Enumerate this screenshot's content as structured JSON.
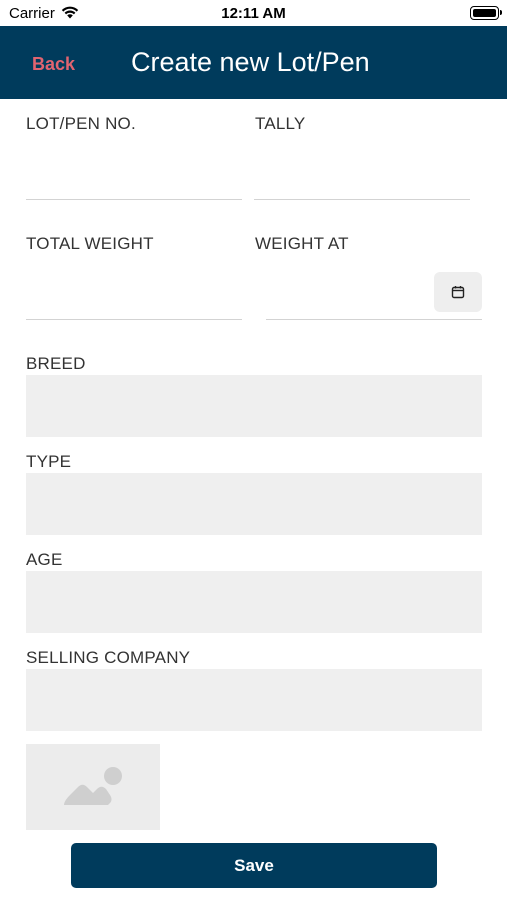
{
  "status_bar": {
    "carrier": "Carrier",
    "time": "12:11 AM"
  },
  "nav": {
    "back_label": "Back",
    "title": "Create new Lot/Pen"
  },
  "form": {
    "lot_pen_no": {
      "label": "LOT/PEN NO.",
      "value": ""
    },
    "tally": {
      "label": "TALLY",
      "value": ""
    },
    "total_weight": {
      "label": "TOTAL WEIGHT",
      "value": ""
    },
    "weight_at": {
      "label": "WEIGHT AT",
      "value": "",
      "icon": "calendar-icon"
    },
    "breed": {
      "label": "BREED",
      "value": ""
    },
    "type": {
      "label": "TYPE",
      "value": ""
    },
    "age": {
      "label": "AGE",
      "value": ""
    },
    "selling_company": {
      "label": "SELLING COMPANY",
      "value": ""
    },
    "photo": {
      "icon": "image-placeholder-icon"
    }
  },
  "actions": {
    "save_label": "Save"
  },
  "colors": {
    "nav_background": "#003b5c",
    "back_text": "#e06470",
    "button_background": "#003b5c",
    "field_background": "#efefef"
  }
}
